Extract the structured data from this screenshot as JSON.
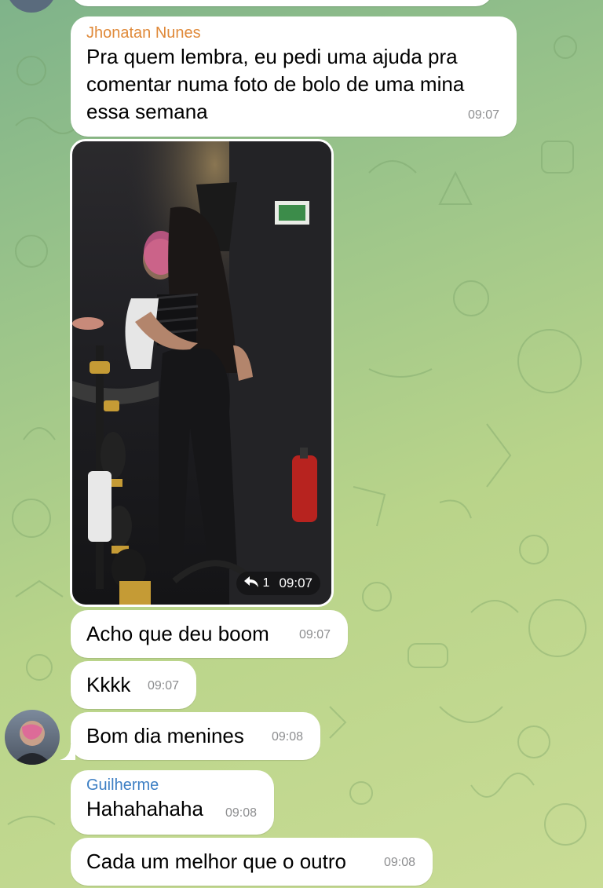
{
  "chat": {
    "messages": [
      {
        "sender": "Jhonatan Nunes",
        "sender_color": "#e08a3a",
        "lines": [
          "Pra quem lembra, eu pedi uma ajuda pra",
          "comentar numa foto de bolo de uma mina",
          "essa semana"
        ],
        "time": "09:07"
      },
      {
        "type": "photo",
        "reply_count": "1",
        "time": "09:07"
      },
      {
        "text": "Acho que deu boom",
        "time": "09:07"
      },
      {
        "text": "Kkkk",
        "time": "09:07"
      },
      {
        "text": "Bom dia menines",
        "time": "09:08"
      },
      {
        "sender": "Guilherme",
        "sender_color": "#3d7fc4",
        "text": "Hahahahaha",
        "time": "09:08"
      },
      {
        "text": "Cada um melhor que o outro",
        "time": "09:08"
      }
    ]
  },
  "icons": {
    "reply": "reply-arrow-icon",
    "avatar": "user-avatar"
  }
}
